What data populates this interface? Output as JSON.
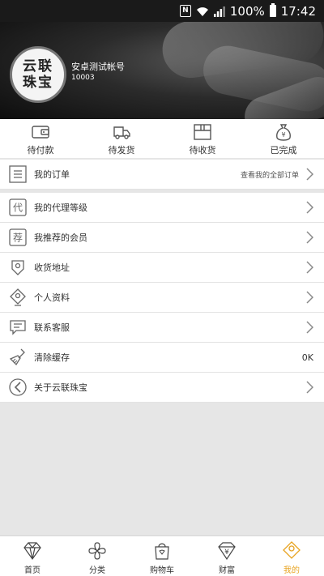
{
  "status_bar": {
    "battery": "100%",
    "time": "17:42"
  },
  "profile": {
    "avatar_text": "云联珠宝",
    "username": "安卓测试帐号",
    "user_id": "10003"
  },
  "order_tabs": [
    {
      "label": "待付款",
      "icon": "wallet-icon"
    },
    {
      "label": "待发货",
      "icon": "truck-icon"
    },
    {
      "label": "待收货",
      "icon": "box-icon"
    },
    {
      "label": "已完成",
      "icon": "money-bag-icon"
    }
  ],
  "my_orders": {
    "label": "我的订单",
    "hint": "查看我的全部订单"
  },
  "menu": [
    {
      "label": "我的代理等级",
      "icon": "agent-icon"
    },
    {
      "label": "我推荐的会员",
      "icon": "recommend-icon"
    },
    {
      "label": "收货地址",
      "icon": "address-icon"
    },
    {
      "label": "个人资料",
      "icon": "profile-icon"
    },
    {
      "label": "联系客服",
      "icon": "chat-icon"
    },
    {
      "label": "清除缓存",
      "icon": "broom-icon",
      "value": "0K"
    },
    {
      "label": "关于云联珠宝",
      "icon": "about-icon"
    }
  ],
  "bottom_nav": [
    {
      "label": "首页",
      "icon": "diamond-icon",
      "active": false
    },
    {
      "label": "分类",
      "icon": "clover-icon",
      "active": false
    },
    {
      "label": "购物车",
      "icon": "shopping-bag-icon",
      "active": false
    },
    {
      "label": "财富",
      "icon": "wealth-icon",
      "active": false
    },
    {
      "label": "我的",
      "icon": "user-icon",
      "active": true
    }
  ],
  "colors": {
    "accent": "#e8a31f",
    "header_bg": "#1a1a1a",
    "background": "#e6e6e6"
  }
}
